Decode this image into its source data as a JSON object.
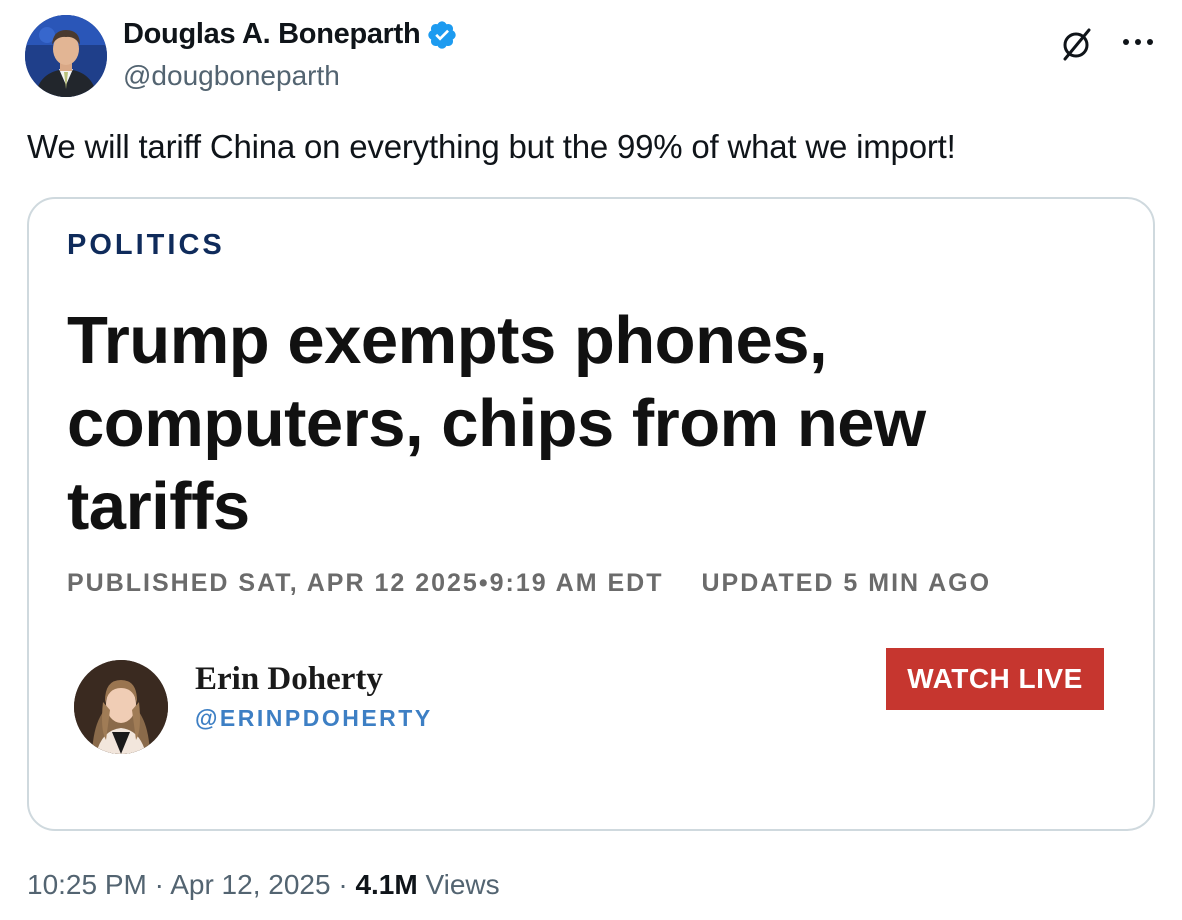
{
  "author": {
    "name": "Douglas A. Boneparth",
    "handle": "@dougboneparth",
    "verified": true
  },
  "icons": {
    "verified": "verified-badge-icon",
    "grok": "grok-icon",
    "more": "more-options-icon"
  },
  "tweet": {
    "text": "We will tariff China on everything but the 99% of what we import!"
  },
  "card": {
    "section": "POLITICS",
    "headline": "Trump exempts phones, computers, chips from new tariffs",
    "published": "PUBLISHED SAT, APR 12 2025•9:19 AM EDT",
    "updated": "UPDATED 5 MIN AGO",
    "author_name": "Erin Doherty",
    "author_handle": "@ERINPDOHERTY",
    "watch_live": "WATCH LIVE"
  },
  "footer": {
    "time": "10:25 PM",
    "sep1": " · ",
    "date": "Apr 12, 2025",
    "sep2": " · ",
    "views_count": "4.1M",
    "views_label": " Views"
  },
  "colors": {
    "verified_blue": "#1d9bf0",
    "section_navy": "#0f2b5b",
    "watch_live_red": "#c6362f",
    "handle_blue": "#3d7fc4",
    "secondary_text": "#536471"
  }
}
